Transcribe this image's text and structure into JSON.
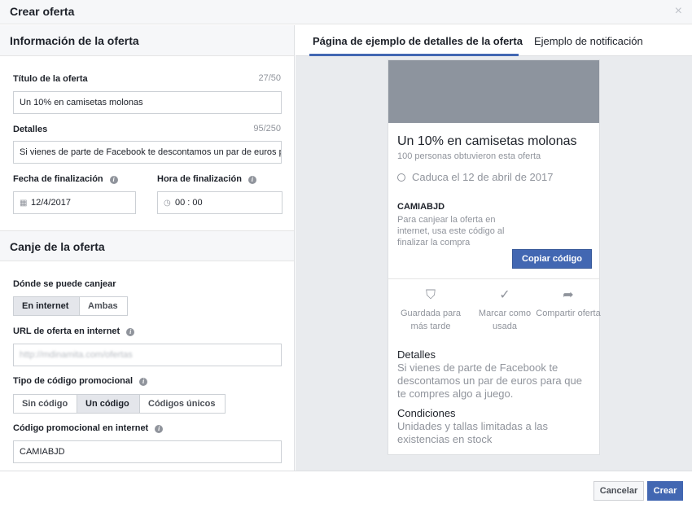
{
  "dialog": {
    "title": "Crear oferta",
    "close_icon": "×"
  },
  "info_section": {
    "title": "Información de la oferta",
    "offer_title_label": "Título de la oferta",
    "offer_title_counter": "27/50",
    "offer_title_value": "Un 10% en camisetas molonas",
    "details_label": "Detalles",
    "details_counter": "95/250",
    "details_value": "Si vienes de parte de Facebook te descontamos un par de euros para que te compres algo a juego.",
    "end_date_label": "Fecha de finalización",
    "end_date_value": "12/4/2017",
    "end_time_label": "Hora de finalización",
    "end_time_value": "00 : 00"
  },
  "redeem_section": {
    "title": "Canje de la oferta",
    "where_label": "Dónde se puede canjear",
    "where_options": [
      "En internet",
      "Ambas"
    ],
    "where_selected": "En internet",
    "url_label": "URL de oferta en internet",
    "url_value": "http://mdinamita.com/ofertas",
    "promo_type_label": "Tipo de código promocional",
    "promo_type_options": [
      "Sin código",
      "Un código",
      "Códigos únicos"
    ],
    "promo_type_selected": "Un código",
    "promo_code_label": "Código promocional en internet",
    "promo_code_value": "CAMIABJD"
  },
  "preview": {
    "tabs": [
      "Página de ejemplo de detalles de la oferta",
      "Ejemplo de notificación"
    ],
    "active_tab": "Página de ejemplo de detalles de la oferta",
    "offer_title": "Un 10% en camisetas molonas",
    "claimed": "100 personas obtuvieron esta oferta",
    "expires": "Caduca el 12 de abril de 2017",
    "code": "CAMIABJD",
    "code_desc": "Para canjear la oferta en internet, usa este código al finalizar la compra",
    "copy_button": "Copiar código",
    "actions": [
      {
        "icon": "bookmark-icon",
        "label": "Guardada para más tarde"
      },
      {
        "icon": "checkmark-icon",
        "label": "Marcar como usada"
      },
      {
        "icon": "share-icon",
        "label": "Compartir oferta"
      }
    ],
    "details_heading": "Detalles",
    "details_text": "Si vienes de parte de Facebook te descontamos un par de euros para que te compres algo a juego.",
    "conditions_heading": "Condiciones",
    "conditions_text": "Unidades y tallas limitadas a las existencias en stock"
  },
  "footer": {
    "cancel": "Cancelar",
    "create": "Crear"
  },
  "colors": {
    "accent": "#4267b2",
    "panel_bg": "#e9ebee",
    "image_placeholder": "#8d949e"
  }
}
